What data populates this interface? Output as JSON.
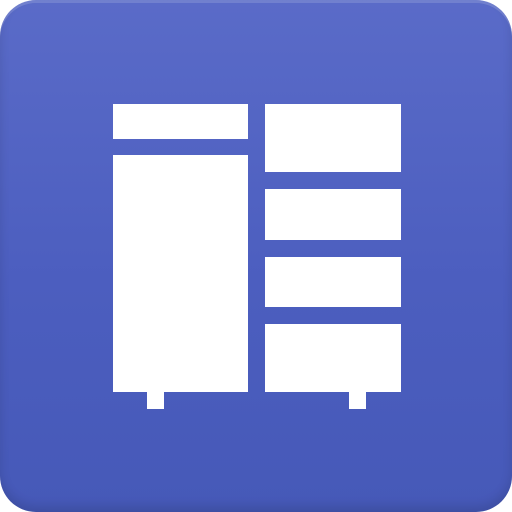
{
  "icon": {
    "name": "wardrobe-icon",
    "background_color": "#4c5ebf",
    "foreground_color": "#ffffff"
  }
}
